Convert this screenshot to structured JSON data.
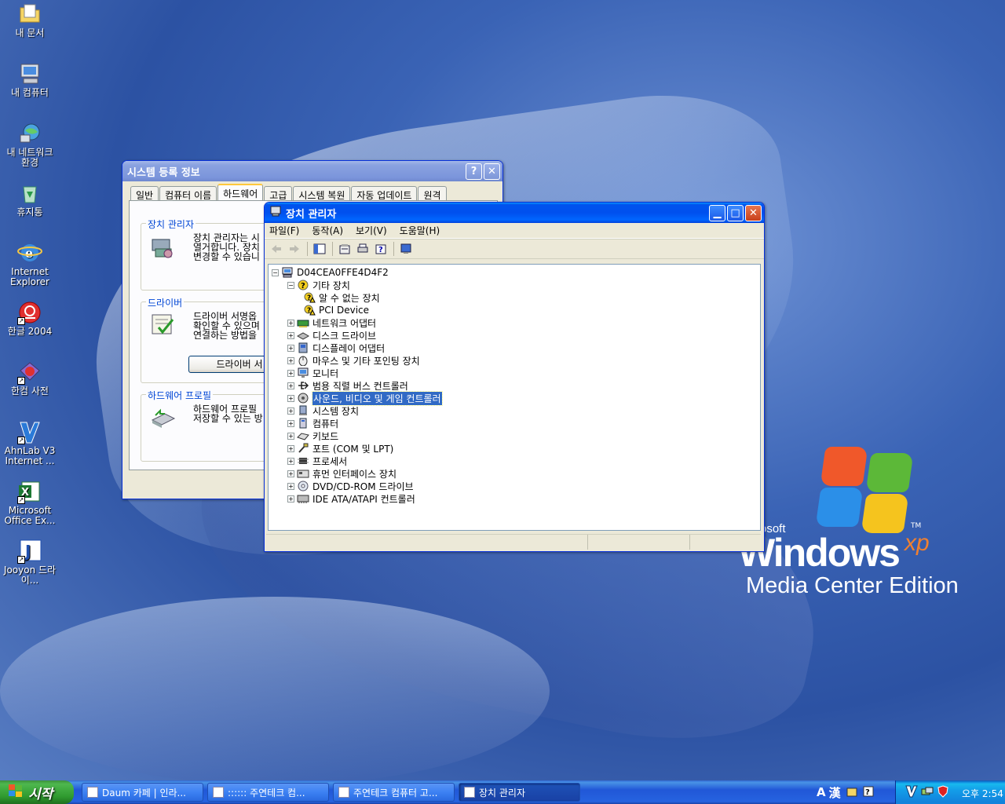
{
  "desktop": {
    "icons": [
      {
        "label": "내 문서",
        "icon": "my-documents-icon"
      },
      {
        "label": "내 컴퓨터",
        "icon": "my-computer-icon"
      },
      {
        "label": "내 네트워크 환경",
        "icon": "network-places-icon"
      },
      {
        "label": "휴지통",
        "icon": "recycle-bin-icon"
      },
      {
        "label": "Internet Explorer",
        "icon": "internet-explorer-icon"
      },
      {
        "label": "한글 2004",
        "icon": "hangul-2004-icon"
      },
      {
        "label": "한컴 사전",
        "icon": "hancom-dictionary-icon"
      },
      {
        "label": "AhnLab V3 Internet ...",
        "icon": "ahnlab-icon"
      },
      {
        "label": "Microsoft Office Ex...",
        "icon": "excel-icon"
      },
      {
        "label": "Jooyon 드라이...",
        "icon": "jooyon-icon"
      }
    ],
    "logo": {
      "ms": "osoft",
      "windows": "Windows",
      "xp": "xp",
      "tm": "TM",
      "edition": "Media Center Edition"
    }
  },
  "sysprops": {
    "title": "시스템 등록 정보",
    "help_label": "?",
    "close_label": "✕",
    "tabs": [
      "일반",
      "컴퓨터 이름",
      "하드웨어",
      "고급",
      "시스템 복원",
      "자동 업데이트",
      "원격"
    ],
    "active_tab": "하드웨어",
    "groups": {
      "device_manager": {
        "title": "장치 관리자",
        "line1": "장치 관리자는 시",
        "line2": "열거합니다. 장치",
        "line3": "변경할 수 있습니"
      },
      "drivers": {
        "title": "드라이버",
        "line1": "드라이버 서명옵",
        "line2": "확인할 수 있으며",
        "line3": "연결하는 방법을",
        "button": "드라이버 서"
      },
      "hw_profiles": {
        "title": "하드웨어 프로필",
        "line1": "하드웨어 프로필",
        "line2": "저장할 수 있는 방"
      }
    }
  },
  "devmgr": {
    "title": "장치 관리자",
    "menus": [
      "파일(F)",
      "동작(A)",
      "보기(V)",
      "도움말(H)"
    ],
    "toolbar": [
      "back-icon",
      "forward-icon",
      "show-hide-tree-icon",
      "properties-icon",
      "print-icon",
      "help-icon",
      "scan-hardware-icon"
    ],
    "root": "D04CEA0FFE4D4F2",
    "tree": [
      {
        "label": "기타 장치",
        "level": 1,
        "expanded": true,
        "icon": "unknown-device-icon"
      },
      {
        "label": "알 수 없는 장치",
        "level": 2,
        "icon": "warning-device-icon"
      },
      {
        "label": "PCI Device",
        "level": 2,
        "icon": "warning-device-icon"
      },
      {
        "label": "네트워크 어댑터",
        "level": 1,
        "icon": "network-adapter-icon"
      },
      {
        "label": "디스크 드라이브",
        "level": 1,
        "icon": "disk-drive-icon"
      },
      {
        "label": "디스플레이 어댑터",
        "level": 1,
        "icon": "display-adapter-icon"
      },
      {
        "label": "마우스 및 기타 포인팅 장치",
        "level": 1,
        "icon": "mouse-icon"
      },
      {
        "label": "모니터",
        "level": 1,
        "icon": "monitor-icon"
      },
      {
        "label": "범용 직렬 버스 컨트롤러",
        "level": 1,
        "icon": "usb-icon"
      },
      {
        "label": "사운드, 비디오 및 게임 컨트롤러",
        "level": 1,
        "icon": "sound-icon",
        "selected": true
      },
      {
        "label": "시스템 장치",
        "level": 1,
        "icon": "system-device-icon"
      },
      {
        "label": "컴퓨터",
        "level": 1,
        "icon": "computer-icon"
      },
      {
        "label": "키보드",
        "level": 1,
        "icon": "keyboard-icon"
      },
      {
        "label": "포트 (COM 및 LPT)",
        "level": 1,
        "icon": "port-icon"
      },
      {
        "label": "프로세서",
        "level": 1,
        "icon": "processor-icon"
      },
      {
        "label": "휴먼 인터페이스 장치",
        "level": 1,
        "icon": "hid-icon"
      },
      {
        "label": "DVD/CD-ROM 드라이브",
        "level": 1,
        "icon": "cdrom-icon"
      },
      {
        "label": "IDE ATA/ATAPI 컨트롤러",
        "level": 1,
        "icon": "ide-controller-icon"
      }
    ]
  },
  "taskbar": {
    "start_label": "시작",
    "tasks": [
      {
        "label": "Daum 카페 | 인라..."
      },
      {
        "label": ":::::: 주연테크 컴..."
      },
      {
        "label": "주연테크 컴퓨터 고..."
      },
      {
        "label": "장치 관리자",
        "active": true
      }
    ],
    "lang_a": "A",
    "lang_han": "漢",
    "clock": "오후 2:54"
  },
  "colors": {
    "title_active": "#0054e3",
    "selection": "#316ac5",
    "start_green": "#3c8f3c"
  }
}
